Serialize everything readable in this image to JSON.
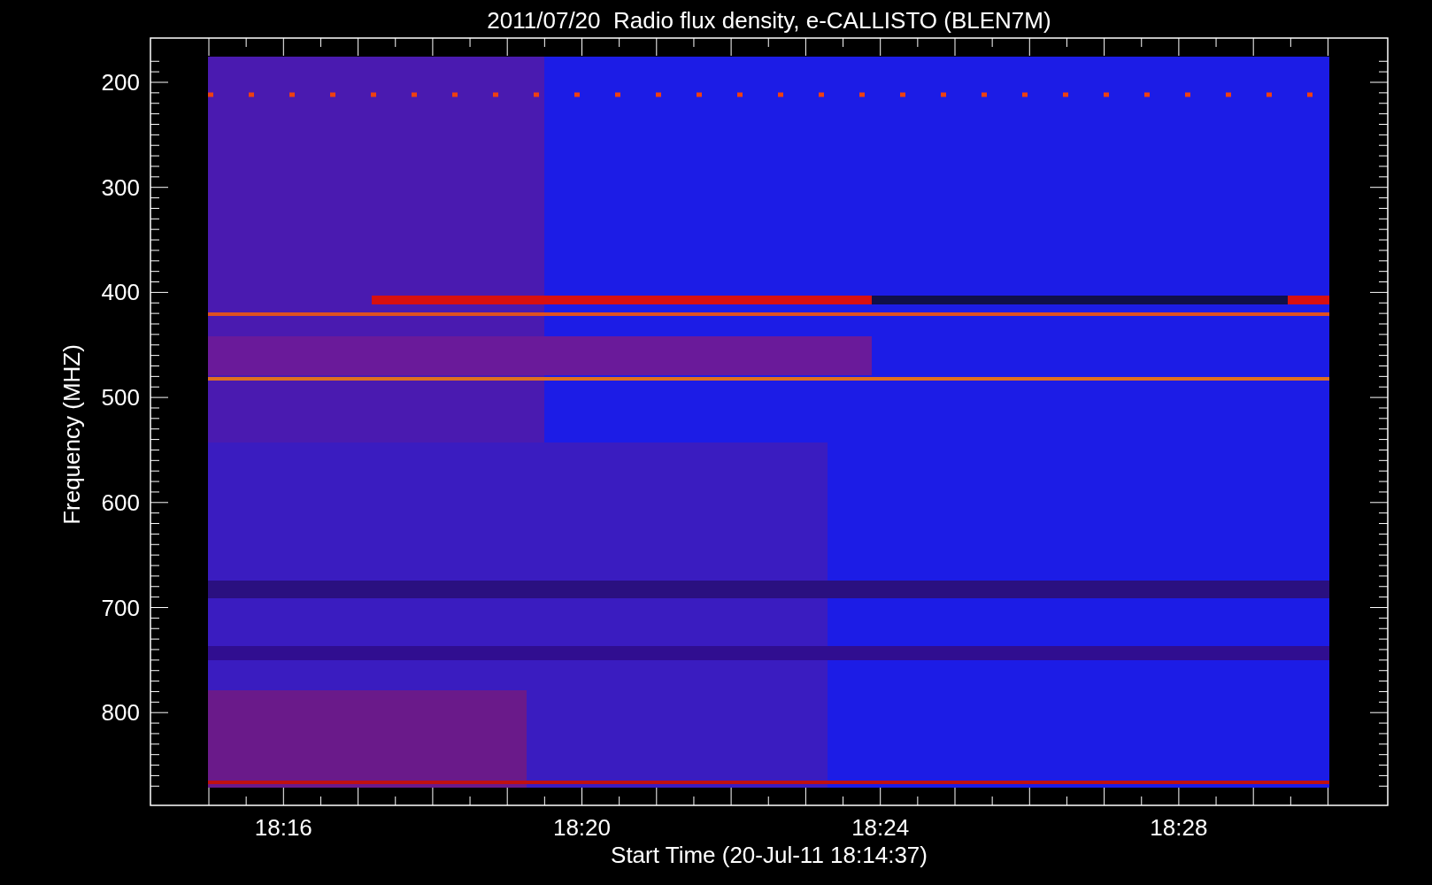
{
  "title": "2011/07/20  Radio flux density, e-CALLISTO (BLEN7M)",
  "x_axis": {
    "label": "Start Time (20-Jul-11 18:14:37)",
    "ticks": [
      "18:16",
      "18:20",
      "18:24",
      "18:28"
    ]
  },
  "y_axis": {
    "label": "Frequency (MHZ)",
    "ticks": [
      "200",
      "300",
      "400",
      "500",
      "600",
      "700",
      "800"
    ]
  }
}
